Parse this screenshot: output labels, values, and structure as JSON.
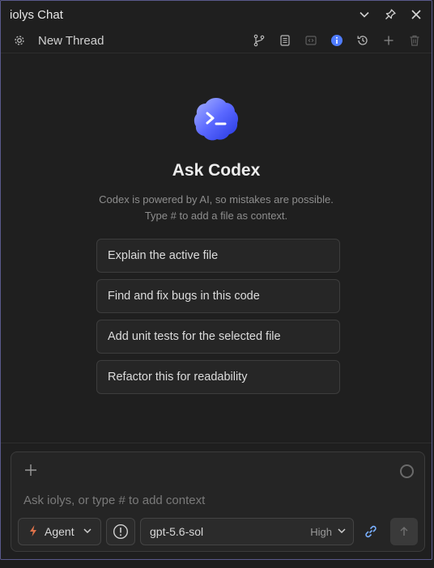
{
  "window": {
    "title": "iolys Chat"
  },
  "toolbar": {
    "thread_title": "New Thread"
  },
  "hero": {
    "heading": "Ask Codex",
    "subtitle_line1": "Codex is powered by AI, so mistakes are possible.",
    "subtitle_line2": "Type # to add a file as context."
  },
  "suggestions": [
    {
      "label": "Explain the active file"
    },
    {
      "label": "Find and fix bugs in this code"
    },
    {
      "label": "Add unit tests for the selected file"
    },
    {
      "label": "Refactor this for readability"
    }
  ],
  "composer": {
    "placeholder": "Ask iolys, or type # to add context",
    "mode_label": "Agent",
    "model_label": "gpt-5.6-sol",
    "effort_label": "High"
  },
  "colors": {
    "accent": "#4f7cff",
    "mode_icon": "#e0734a",
    "link_icon": "#7ab0ff"
  }
}
